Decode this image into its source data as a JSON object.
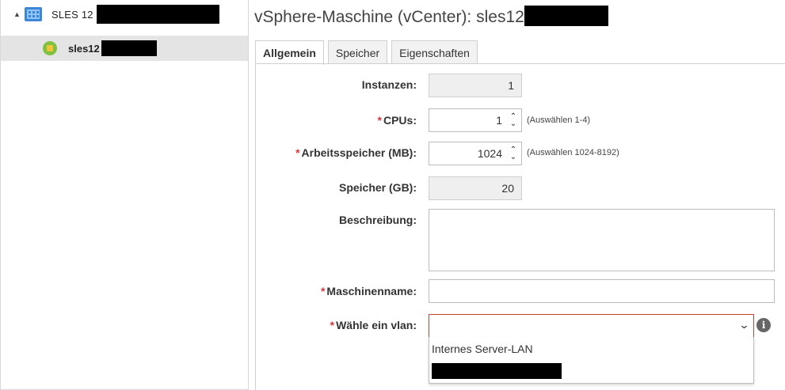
{
  "tree": {
    "root": {
      "label": "SLES 12",
      "expander": "▲"
    },
    "child": {
      "label": "sles12"
    }
  },
  "main": {
    "title": "vSphere-Maschine (vCenter): sles12",
    "tabs": [
      {
        "label": "Allgemein",
        "active": true
      },
      {
        "label": "Speicher",
        "active": false
      },
      {
        "label": "Eigenschaften",
        "active": false
      }
    ]
  },
  "form": {
    "instances": {
      "label": "Instanzen:",
      "value": "1"
    },
    "cpus": {
      "required_mark": "*",
      "label": "CPUs:",
      "value": "1",
      "hint": "(Auswählen 1-4)"
    },
    "memory": {
      "required_mark": "*",
      "label": "Arbeitsspeicher (MB):",
      "value": "1024",
      "hint": "(Auswählen 1024-8192)"
    },
    "storage": {
      "label": "Speicher (GB):",
      "value": "20"
    },
    "description": {
      "label": "Beschreibung:",
      "value": ""
    },
    "machine_name": {
      "required_mark": "*",
      "label": "Maschinenname:",
      "value": ""
    },
    "vlan": {
      "required_mark": "*",
      "label": "Wähle ein vlan:",
      "value": "",
      "options": [
        "Internes Server-LAN"
      ]
    }
  },
  "icons": {
    "expander": "triangle-expand-icon",
    "group": "vm-group-icon",
    "vm": "vm-status-icon",
    "chevron": "chevron-down-icon",
    "info": "info-icon"
  },
  "colors": {
    "required": "#d9363e",
    "select_border": "#c9432d",
    "tree_selected_bg": "#e4e4e4"
  }
}
